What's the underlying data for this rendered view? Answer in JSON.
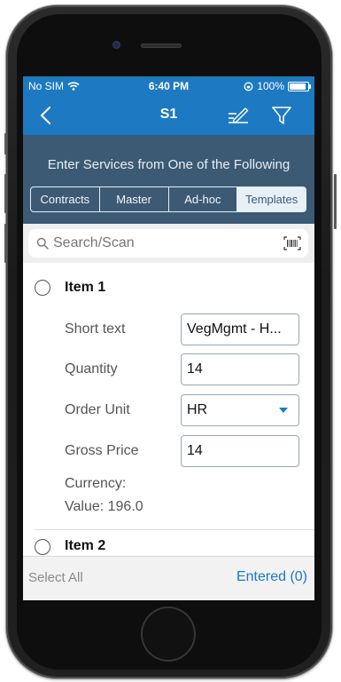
{
  "status_bar": {
    "carrier": "No SIM",
    "time": "6:40 PM",
    "battery": "100%",
    "battery_level": 1.0
  },
  "nav": {
    "title": "S1",
    "icons": {
      "back": "chevron-left-icon",
      "edit": "edit-lines-icon",
      "filter": "filter-icon"
    }
  },
  "header": {
    "prompt": "Enter Services from One of the Following",
    "segments": [
      "Contracts",
      "Master",
      "Ad-hoc",
      "Templates"
    ],
    "active_segment": "Templates"
  },
  "search": {
    "placeholder": "Search/Scan",
    "value": ""
  },
  "items": [
    {
      "title": "Item 1",
      "short_text_label": "Short text",
      "short_text_value": "VegMgmt - H...",
      "quantity_label": "Quantity",
      "quantity_value": "14",
      "order_unit_label": "Order Unit",
      "order_unit_value": "HR",
      "gross_price_label": "Gross Price",
      "gross_price_value": "14",
      "currency_label": "Currency:",
      "value_label": "Value: 196.0"
    },
    {
      "title": "Item 2"
    }
  ],
  "footer": {
    "select_all": "Select All",
    "entered": "Entered (0)"
  },
  "colors": {
    "brand_blue": "#1d7ac2",
    "header_slate": "#3c5a74",
    "link_blue": "#1a78c6"
  }
}
